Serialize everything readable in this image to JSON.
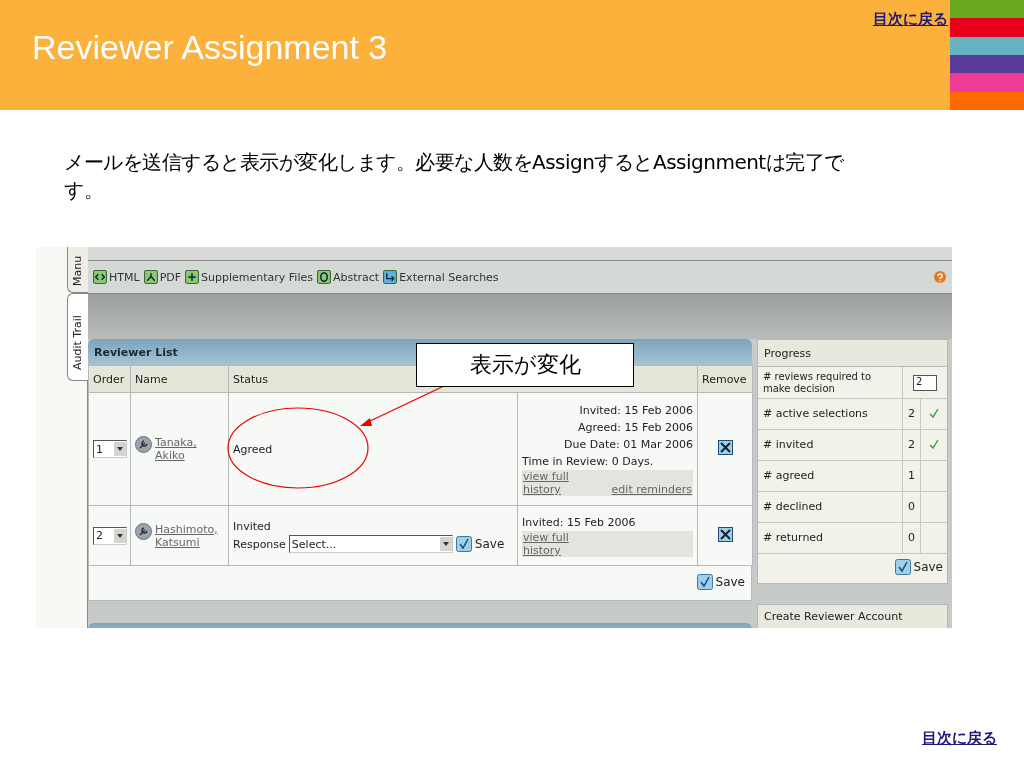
{
  "header": {
    "title": "Reviewer Assignment 3",
    "toc_link": "目次に戻る"
  },
  "intro": "メールを送信すると表示が変化します。必要な人数をAssignするとAssignmentは完了です。",
  "app": {
    "side_tabs": [
      {
        "label": "Manu",
        "selected": true
      },
      {
        "label": "Audit Trail",
        "selected": false
      }
    ],
    "toolbar": [
      {
        "label": "HTML",
        "kind": "html"
      },
      {
        "label": "PDF",
        "kind": "pdf"
      },
      {
        "label": "Supplementary Files",
        "kind": "plus"
      },
      {
        "label": "Abstract",
        "kind": "abstract"
      },
      {
        "label": "External Searches",
        "kind": "external"
      }
    ],
    "reviewer_list": {
      "title": "Reviewer List",
      "columns": [
        "Order",
        "Name",
        "Status",
        "Remove"
      ],
      "rows": [
        {
          "order": "1",
          "name": [
            "Tanaka,",
            "Akiko"
          ],
          "status": "Agreed",
          "kind": "agreed",
          "dates": [
            "Invited: 15 Feb 2006",
            "Agreed: 15 Feb 2006",
            "Due Date: 01 Mar 2006"
          ],
          "time": "Time in Review: 0 Days.",
          "links": [
            "view full history",
            "edit reminders"
          ]
        },
        {
          "order": "2",
          "name": [
            "Hashimoto,",
            "Katsumi"
          ],
          "status": "Invited",
          "kind": "invited",
          "response_label": "Response",
          "response_placeholder": "Select...",
          "save": "Save",
          "dates": [
            "Invited: 15 Feb 2006"
          ],
          "links": [
            "view full history"
          ]
        }
      ],
      "save": "Save"
    },
    "progress": {
      "title": "Progress",
      "rows": [
        {
          "label": "# reviews required to make decision",
          "value": "2",
          "kind": "input"
        },
        {
          "label": "# active selections",
          "value": "2",
          "kind": "count",
          "checked": true
        },
        {
          "label": "# invited",
          "value": "2",
          "kind": "count",
          "checked": true
        },
        {
          "label": "# agreed",
          "value": "1",
          "kind": "count",
          "checked": false
        },
        {
          "label": "# declined",
          "value": "0",
          "kind": "count",
          "checked": false
        },
        {
          "label": "# returned",
          "value": "0",
          "kind": "count",
          "checked": false
        }
      ],
      "save": "Save",
      "next_panel": "Create Reviewer Account"
    },
    "callout": "表示が変化"
  },
  "footer": {
    "toc_link": "目次に戻る"
  }
}
